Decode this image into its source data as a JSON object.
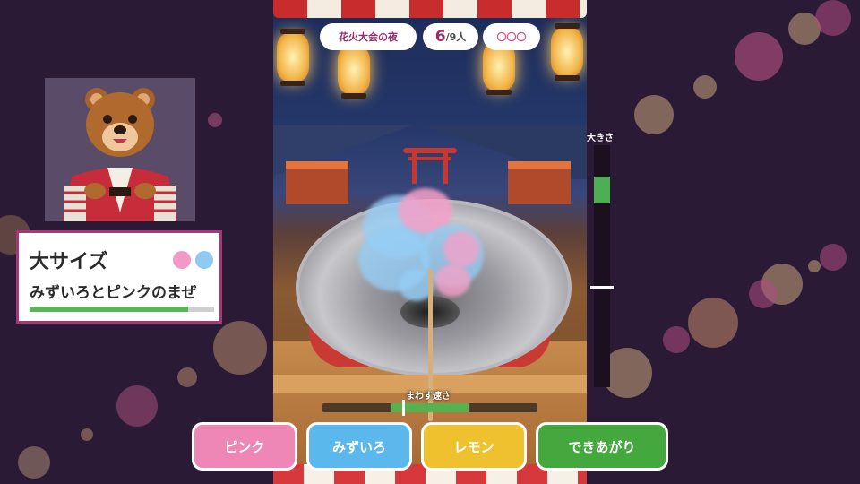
{
  "hud": {
    "event_name": "花火大会の夜",
    "served_count": "6",
    "served_total": "/9人",
    "rating": "〇〇〇"
  },
  "order": {
    "size": "大サイズ",
    "flavor": "みずいろとピンクのまぜ",
    "progress": 0.86,
    "color_dots": [
      "#f29ac6",
      "#8fcaf2"
    ]
  },
  "gauges": {
    "size_label": "大きさ",
    "size_target_band": [
      0.76,
      0.87
    ],
    "size_current": 0.42,
    "speed_label": "まわす速さ",
    "speed_target_band": [
      0.32,
      0.68
    ],
    "speed_current": 0.37
  },
  "buttons": {
    "pink": "ピンク",
    "blue": "みずいろ",
    "lemon": "レモン",
    "done": "できあがり"
  },
  "colors": {
    "pink": "#ee86b6",
    "blue": "#5bb7ec",
    "lemon": "#f0c12f",
    "done": "#45a83f",
    "accent": "#a83779"
  }
}
